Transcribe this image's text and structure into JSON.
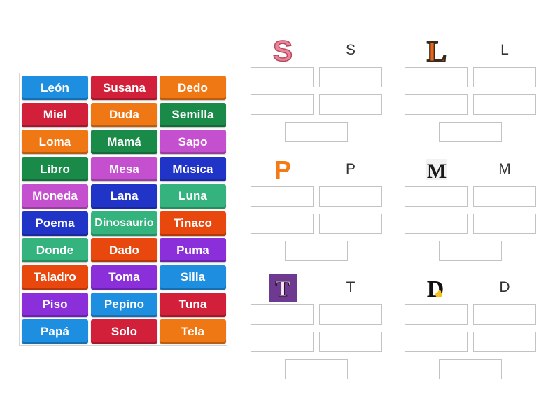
{
  "tiles": [
    {
      "label": "León",
      "color": "#1e8fe0"
    },
    {
      "label": "Susana",
      "color": "#d21f3a"
    },
    {
      "label": "Dedo",
      "color": "#f07814"
    },
    {
      "label": "Miel",
      "color": "#d21f3a"
    },
    {
      "label": "Duda",
      "color": "#f07814"
    },
    {
      "label": "Semilla",
      "color": "#1a8a49"
    },
    {
      "label": "Loma",
      "color": "#f07814"
    },
    {
      "label": "Mamá",
      "color": "#1a8a49"
    },
    {
      "label": "Sapo",
      "color": "#c550cf"
    },
    {
      "label": "Libro",
      "color": "#1a8a49"
    },
    {
      "label": "Mesa",
      "color": "#c550cf"
    },
    {
      "label": "Música",
      "color": "#2134c8"
    },
    {
      "label": "Moneda",
      "color": "#c550cf"
    },
    {
      "label": "Lana",
      "color": "#2134c8"
    },
    {
      "label": "Luna",
      "color": "#35b37e"
    },
    {
      "label": "Poema",
      "color": "#2134c8"
    },
    {
      "label": "Dinosaurio",
      "color": "#35b37e"
    },
    {
      "label": "Tinaco",
      "color": "#e8470e"
    },
    {
      "label": "Donde",
      "color": "#35b37e"
    },
    {
      "label": "Dado",
      "color": "#e8470e"
    },
    {
      "label": "Puma",
      "color": "#8a2fd9"
    },
    {
      "label": "Taladro",
      "color": "#e8470e"
    },
    {
      "label": "Toma",
      "color": "#8a2fd9"
    },
    {
      "label": "Silla",
      "color": "#1e8fe0"
    },
    {
      "label": "Piso",
      "color": "#8a2fd9"
    },
    {
      "label": "Pepino",
      "color": "#1e8fe0"
    },
    {
      "label": "Tuna",
      "color": "#d21f3a"
    },
    {
      "label": "Papá",
      "color": "#1e8fe0"
    },
    {
      "label": "Solo",
      "color": "#d21f3a"
    },
    {
      "label": "Tela",
      "color": "#f07814"
    }
  ],
  "groups": [
    {
      "letter": "S",
      "icon": "letter-s-icon"
    },
    {
      "letter": "L",
      "icon": "letter-l-icon"
    },
    {
      "letter": "P",
      "icon": "letter-p-icon"
    },
    {
      "letter": "M",
      "icon": "letter-m-icon"
    },
    {
      "letter": "T",
      "icon": "letter-t-icon"
    },
    {
      "letter": "D",
      "icon": "letter-d-icon"
    }
  ]
}
